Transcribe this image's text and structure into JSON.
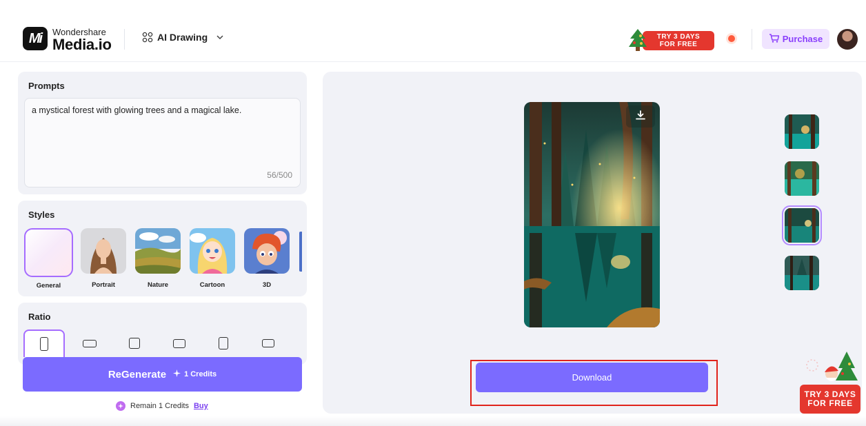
{
  "header": {
    "brand_top": "Wondershare",
    "brand_bottom": "Media.io",
    "logo_mark": "Mi",
    "tool_name": "AI Drawing",
    "promo_line1": "TRY 3 DAYS",
    "promo_line2": "FOR FREE",
    "purchase_label": "Purchase"
  },
  "prompt": {
    "title": "Prompts",
    "text": "a mystical forest with glowing trees and a magical lake.",
    "count": "56/500"
  },
  "styles": {
    "title": "Styles",
    "items": [
      {
        "label": "General",
        "selected": true
      },
      {
        "label": "Portrait",
        "selected": false
      },
      {
        "label": "Nature",
        "selected": false
      },
      {
        "label": "Cartoon",
        "selected": false
      },
      {
        "label": "3D",
        "selected": false
      }
    ]
  },
  "ratio": {
    "title": "Ratio"
  },
  "actions": {
    "regenerate_label": "ReGenerate",
    "credits_label": "1 Credits",
    "remain_label": "Remain 1 Credits",
    "buy_label": "Buy",
    "download_label": "Download"
  },
  "corner_promo": {
    "line1": "TRY 3 DAYS",
    "line2": "FOR FREE"
  },
  "colors": {
    "accent": "#7b6bff",
    "selection": "#a56cff",
    "promo_red": "#e4372e",
    "highlight_box": "#e0231b"
  },
  "icons": {
    "tool_switch": "grid-icon",
    "dropdown": "chevron-down-icon",
    "purchase": "cart-icon",
    "image_download": "download-icon",
    "credits": "sparkle-icon",
    "remain": "credit-coin-icon"
  }
}
